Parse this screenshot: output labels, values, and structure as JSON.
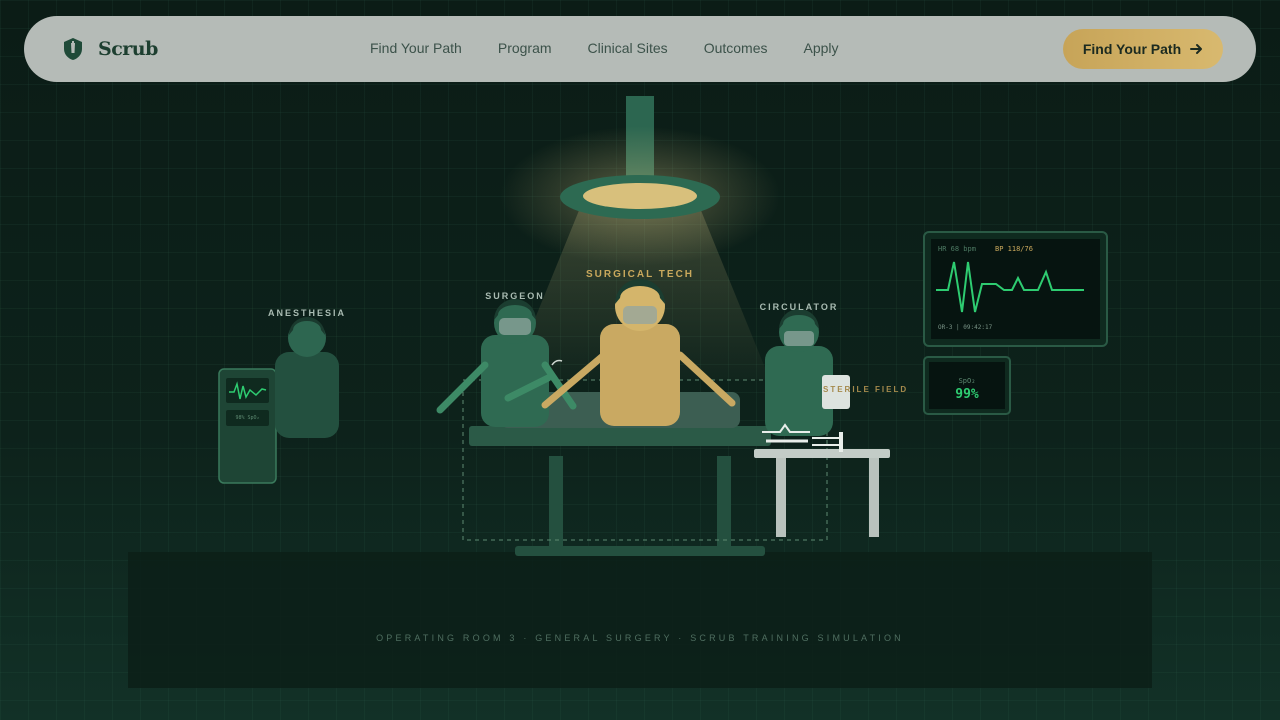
{
  "brand": {
    "name": "Scrub"
  },
  "nav": {
    "links": [
      "Find Your Path",
      "Program",
      "Clinical Sites",
      "Outcomes",
      "Apply"
    ],
    "cta_label": "Find Your Path"
  },
  "scene": {
    "roles": {
      "anesthesia": "ANESTHESIA",
      "surgeon": "SURGEON",
      "surgical_tech": "SURGICAL TECH",
      "circulator": "CIRCULATOR"
    },
    "sterile_field": "STERILE FIELD",
    "monitor": {
      "hr": "HR 68 bpm",
      "bp": "BP 118/76",
      "footer": "OR-3 | 09:42:17"
    },
    "spo2": {
      "label": "SpO₂",
      "value": "99%"
    },
    "anesthesia_cart": {
      "readout": "98% SpO₂"
    },
    "caption": "OPERATING ROOM 3 · GENERAL SURGERY · SCRUB TRAINING SIMULATION"
  },
  "colors": {
    "accent": "#c9a85c",
    "nav_bg": "#b5bbb7",
    "ecg": "#2ecc71",
    "scene_green": "#2c6650"
  },
  "icons": {
    "logo": "shield-scalpel-icon",
    "cta": "arrow-right-icon"
  }
}
